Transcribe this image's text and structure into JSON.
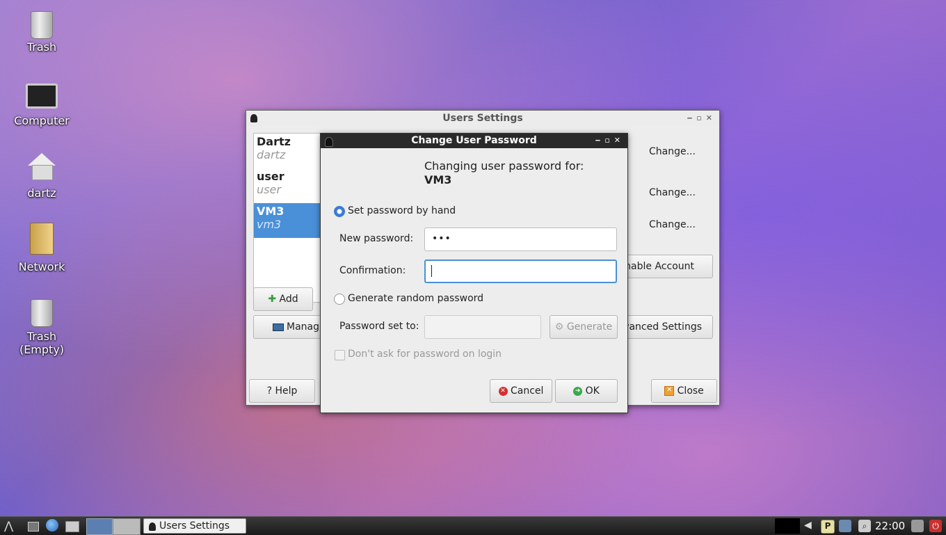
{
  "desktop": {
    "icons": [
      {
        "label": "Trash"
      },
      {
        "label": "Computer"
      },
      {
        "label": "dartz"
      },
      {
        "label": "Network"
      },
      {
        "label": "Trash\n(Empty)"
      }
    ]
  },
  "users_window": {
    "title": "Users Settings",
    "users": [
      {
        "name": "Dartz",
        "login": "dartz"
      },
      {
        "name": "user",
        "login": "user"
      },
      {
        "name": "VM3",
        "login": "vm3"
      }
    ],
    "change_labels": [
      "Change...",
      "Change...",
      "Change..."
    ],
    "enable_account_label": "nable Account",
    "advanced_settings_label": "vanced Settings",
    "add_label": "Add",
    "manage_label": "Manag",
    "help_label": "Help",
    "close_label": "Close"
  },
  "password_dialog": {
    "title": "Change User Password",
    "heading": "Changing user password for:",
    "username": "VM3",
    "set_by_hand_label": "Set password by hand",
    "new_password_label": "New password:",
    "new_password_value": "•••",
    "confirmation_label": "Confirmation:",
    "confirmation_value": "",
    "generate_random_label": "Generate random password",
    "password_set_to_label": "Password set to:",
    "generate_label": "Generate",
    "dont_ask_label": "Don't ask for password on login",
    "cancel_label": "Cancel",
    "ok_label": "OK"
  },
  "taskbar": {
    "task_label": "Users Settings",
    "clock": "22:00"
  },
  "colors": {
    "accent": "#4a90d9",
    "dialog_titlebar": "#2a2a2a"
  }
}
